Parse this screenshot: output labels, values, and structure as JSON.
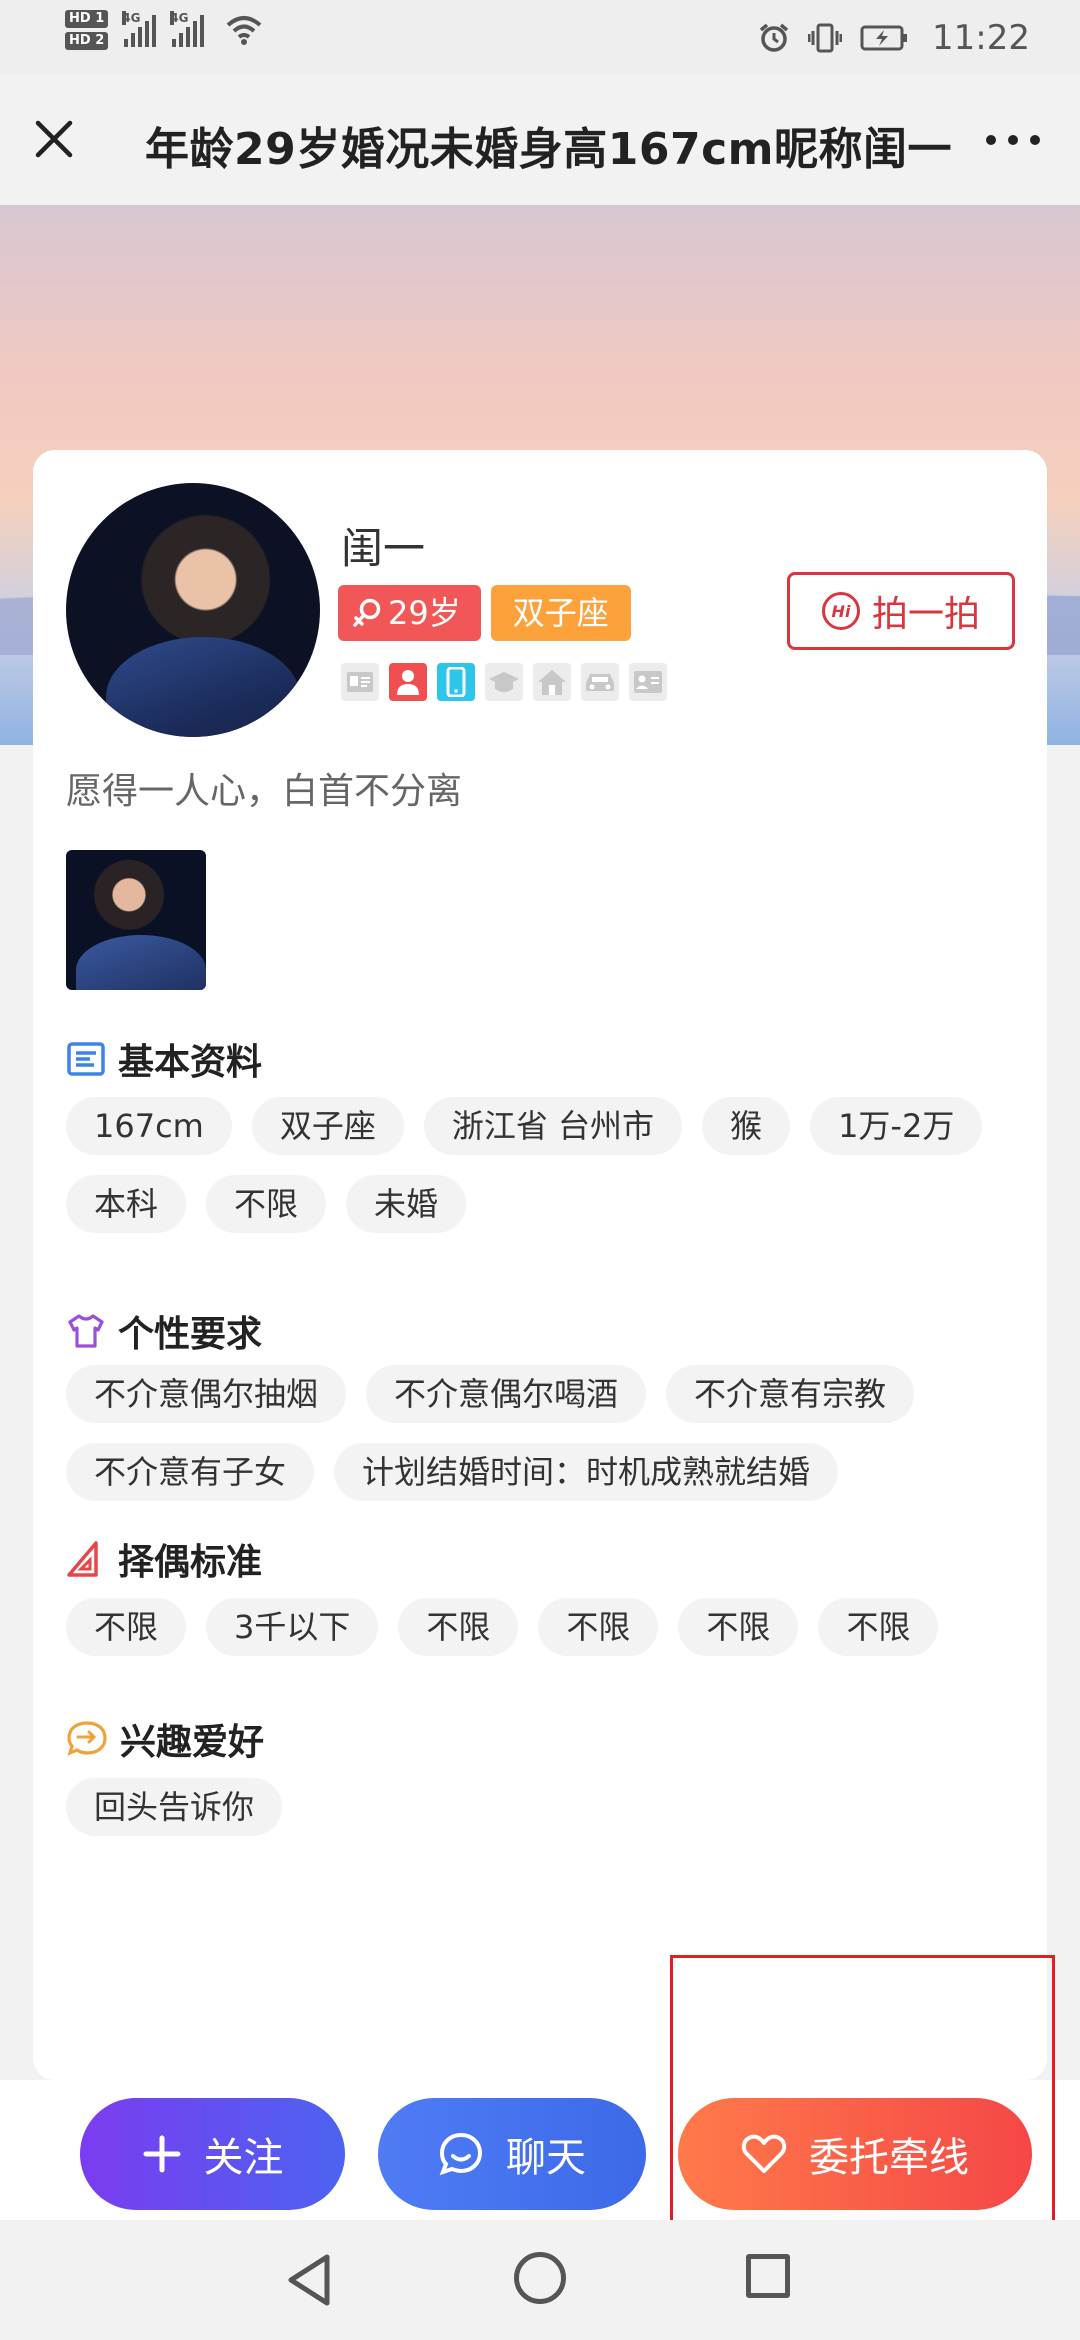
{
  "status_bar": {
    "hd1": "HD 1",
    "hd2": "HD 2",
    "net1": "4G",
    "net2": "4G",
    "time": "11:22"
  },
  "header": {
    "title": "年龄29岁婚况未婚身高167cm昵称闺一"
  },
  "profile": {
    "nickname": "闺一",
    "age_tag": "29岁",
    "zodiac_tag": "双子座",
    "hi_button": "拍一拍",
    "hi_icon_text": "Hi",
    "motto": "愿得一人心，白首不分离"
  },
  "sections": {
    "basic": {
      "title": "基本资料",
      "items": [
        "167cm",
        "双子座",
        "浙江省 台州市",
        "猴",
        "1万-2万",
        "本科",
        "不限",
        "未婚"
      ]
    },
    "personality": {
      "title": "个性要求",
      "items": [
        "不介意偶尔抽烟",
        "不介意偶尔喝酒",
        "不介意有宗教",
        "不介意有子女",
        "计划结婚时间：时机成熟就结婚"
      ]
    },
    "partner": {
      "title": "择偶标准",
      "items": [
        "不限",
        "3千以下",
        "不限",
        "不限",
        "不限",
        "不限"
      ]
    },
    "hobbies": {
      "title": "兴趣爱好",
      "items": [
        "回头告诉你"
      ]
    }
  },
  "actions": {
    "follow": "关注",
    "chat": "聊天",
    "matchmake": "委托牵线"
  },
  "colors": {
    "accent_red": "#d9363e",
    "age_tag": "#f25757",
    "zodiac_tag": "#fda23a",
    "follow_gradient": "#7b3cf0",
    "chat_gradient": "#4f7cf5",
    "match_gradient": "#f54747"
  }
}
